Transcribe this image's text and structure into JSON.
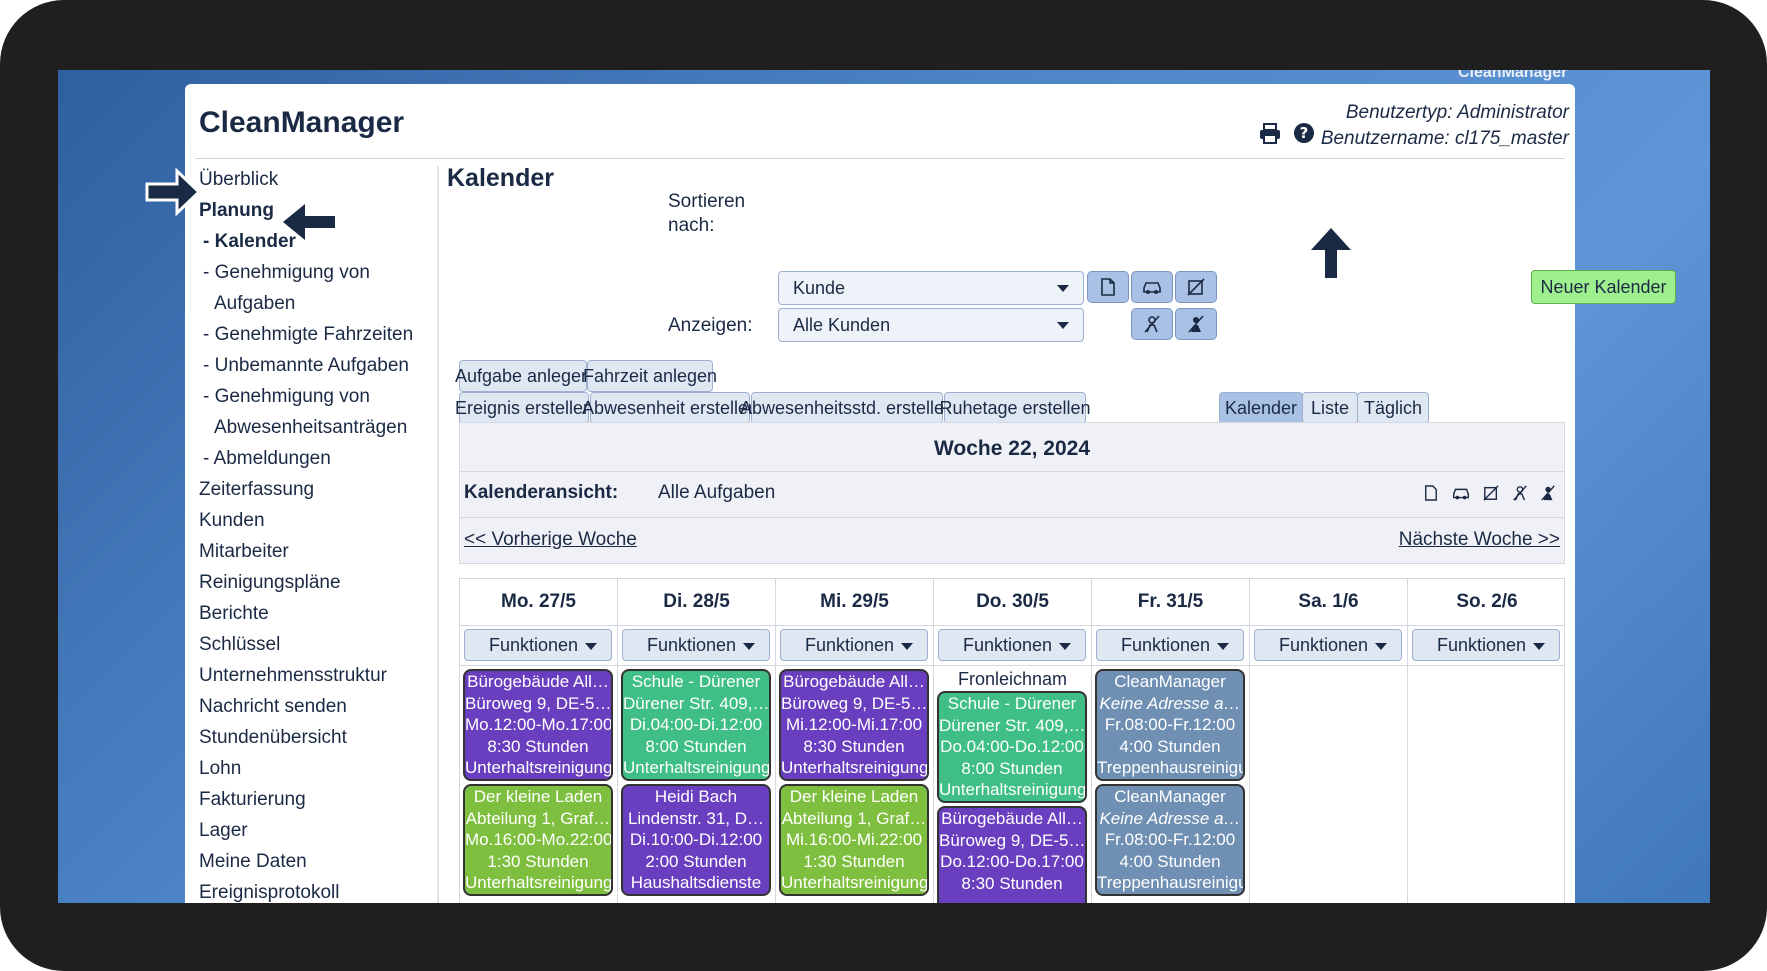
{
  "window_title": "CleanManager",
  "header": {
    "app_title": "CleanManager",
    "user_type": "Benutzertyp: Administrator",
    "user_name": "Benutzername: cl175_master"
  },
  "sidebar": {
    "items": [
      {
        "label": "Überblick"
      },
      {
        "label": "Planung"
      },
      {
        "label": "- Kalender"
      },
      {
        "label": "- Genehmigung von",
        "cont": "Aufgaben"
      },
      {
        "label": "- Genehmigte Fahrzeiten"
      },
      {
        "label": "- Unbemannte Aufgaben"
      },
      {
        "label": "- Genehmigung von",
        "cont": "Abwesenheitsanträgen"
      },
      {
        "label": "- Abmeldungen"
      },
      {
        "label": "Zeiterfassung"
      },
      {
        "label": "Kunden"
      },
      {
        "label": "Mitarbeiter"
      },
      {
        "label": "Reinigungspläne"
      },
      {
        "label": "Berichte"
      },
      {
        "label": "Schlüssel"
      },
      {
        "label": "Unternehmensstruktur"
      },
      {
        "label": "Nachricht senden"
      },
      {
        "label": "Stundenübersicht"
      },
      {
        "label": "Lohn"
      },
      {
        "label": "Fakturierung"
      },
      {
        "label": "Lager"
      },
      {
        "label": "Meine Daten"
      },
      {
        "label": "Ereignisprotokoll"
      }
    ]
  },
  "main": {
    "title": "Kalender",
    "sort_label_1": "Sortieren",
    "sort_label_2": "nach:",
    "sort_value": "Kunde",
    "show_label": "Anzeigen:",
    "show_value": "Alle Kunden",
    "new_calendar": "Neuer Kalender",
    "buttons": {
      "task": "Aufgabe anlegen",
      "drive": "Fahrzeit anlegen",
      "event": "Ereignis erstellen",
      "absence": "Abwesenheit erstellen",
      "absence_hours": "Abwesenheitsstd. erstellen",
      "rest_days": "Ruhetage erstellen"
    },
    "views": {
      "calendar": "Kalender",
      "list": "Liste",
      "daily": "Täglich"
    },
    "week": "Woche 22, 2024",
    "view_label": "Kalenderansicht:",
    "view_value": "Alle Aufgaben",
    "prev": "<< Vorherige Woche",
    "next": "Nächste Woche >>",
    "functions_label": "Funktionen",
    "days": [
      {
        "head": "Mo. 27/5"
      },
      {
        "head": "Di. 28/5"
      },
      {
        "head": "Mi. 29/5"
      },
      {
        "head": "Do. 30/5",
        "holiday": "Fronleichnam"
      },
      {
        "head": "Fr. 31/5"
      },
      {
        "head": "Sa. 1/6"
      },
      {
        "head": "So. 2/6"
      }
    ],
    "cards": {
      "mo1": [
        "Bürogebäude All…",
        "Büroweg 9, DE-5…",
        "Mo.12:00-Mo.17:00",
        "8:30 Stunden",
        "Unterhaltsreinigung"
      ],
      "mo2": [
        "Der kleine Laden",
        "Abteilung 1, Graf…",
        "Mo.16:00-Mo.22:00",
        "1:30 Stunden",
        "Unterhaltsreinigung"
      ],
      "di1": [
        "Schule - Dürener",
        "Dürener Str. 409,…",
        "Di.04:00-Di.12:00",
        "8:00 Stunden",
        "Unterhaltsreinigung"
      ],
      "di2": [
        "Heidi Bach",
        "Lindenstr. 31, D…",
        "Di.10:00-Di.12:00",
        "2:00 Stunden",
        "Haushaltsdienste"
      ],
      "mi1": [
        "Bürogebäude All…",
        "Büroweg 9, DE-5…",
        "Mi.12:00-Mi.17:00",
        "8:30 Stunden",
        "Unterhaltsreinigung"
      ],
      "mi2": [
        "Der kleine Laden",
        "Abteilung 1, Graf…",
        "Mi.16:00-Mi.22:00",
        "1:30 Stunden",
        "Unterhaltsreinigung"
      ],
      "do1": [
        "Schule - Dürener",
        "Dürener Str. 409,…",
        "Do.04:00-Do.12:00",
        "8:00 Stunden",
        "Unterhaltsreinigung"
      ],
      "do2": [
        "Bürogebäude All…",
        "Büroweg 9, DE-5…",
        "Do.12:00-Do.17:00",
        "8:30 Stunden"
      ],
      "fr1": [
        "CleanManager",
        "Keine Adresse a…",
        "Fr.08:00-Fr.12:00",
        "4:00 Stunden",
        "Treppenhausreinigu"
      ],
      "fr2": [
        "CleanManager",
        "Keine Adresse a…",
        "Fr.08:00-Fr.12:00",
        "4:00 Stunden",
        "Treppenhausreinigu"
      ]
    },
    "colors": {
      "purple": "#6a3fbf",
      "teal": "#3fbf86",
      "lime": "#7fbf3f",
      "gray": "#6f8fb3",
      "new_calendar": "#9ef08e"
    }
  }
}
